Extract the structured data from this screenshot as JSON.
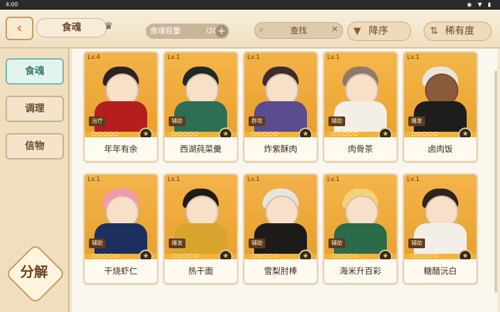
{
  "status_bar": {
    "time": "4:00",
    "icons": "◉ ▼ ▮"
  },
  "header": {
    "back_icon": "‹",
    "title": "食魂",
    "crown_icon": "♛",
    "capacity": {
      "label": "食魂容量",
      "current": "18",
      "total": "/200",
      "plus_icon": "+"
    },
    "search": {
      "icon": "⌕",
      "text": "查找",
      "clear_icon": "✕"
    },
    "sort_button": {
      "icon": "▼",
      "label": "降序"
    },
    "rarity_button": {
      "icon": "⇅",
      "label": "稀有度"
    }
  },
  "sidebar": {
    "tabs": [
      "食魂",
      "调理",
      "信物"
    ],
    "decompose_label": "分解"
  },
  "cards": [
    {
      "level": "Lv.4",
      "role": "治疗",
      "stars": "○○○○○",
      "badge": "★",
      "name": "年年有余"
    },
    {
      "level": "Lv.1",
      "role": "辅助",
      "stars": "○○○○○",
      "badge": "★",
      "name": "西湖莼菜羹"
    },
    {
      "level": "Lv.1",
      "role": "群攻",
      "stars": "○○○○○",
      "badge": "★",
      "name": "炸紫酥肉"
    },
    {
      "level": "Lv.1",
      "role": "辅助",
      "stars": "○○○○○",
      "badge": "★",
      "name": "肉骨茶"
    },
    {
      "level": "Lv.1",
      "role": "爆发",
      "stars": "○○○○○",
      "badge": "★",
      "name": "卤肉饭"
    },
    {
      "level": "Lv.1",
      "role": "辅助",
      "stars": "○○○○○",
      "badge": "★",
      "name": "干烧虾仁"
    },
    {
      "level": "Lv.1",
      "role": "爆发",
      "stars": "○○○○○",
      "badge": "★",
      "name": "热干面"
    },
    {
      "level": "Lv.1",
      "role": "辅助",
      "stars": "○○○○○",
      "badge": "★",
      "name": "雪梨肘棒"
    },
    {
      "level": "Lv.1",
      "role": "辅助",
      "stars": "○○○○○",
      "badge": "★",
      "name": "海米升百彩"
    },
    {
      "level": "Lv.1",
      "role": "辅助",
      "stars": "○○○○○",
      "badge": "★",
      "name": "糖醋沅白"
    }
  ],
  "colors": {
    "accent_orange": "#e1772c",
    "card_gold": "#f4b334",
    "tab_active": "#78b7a6"
  }
}
